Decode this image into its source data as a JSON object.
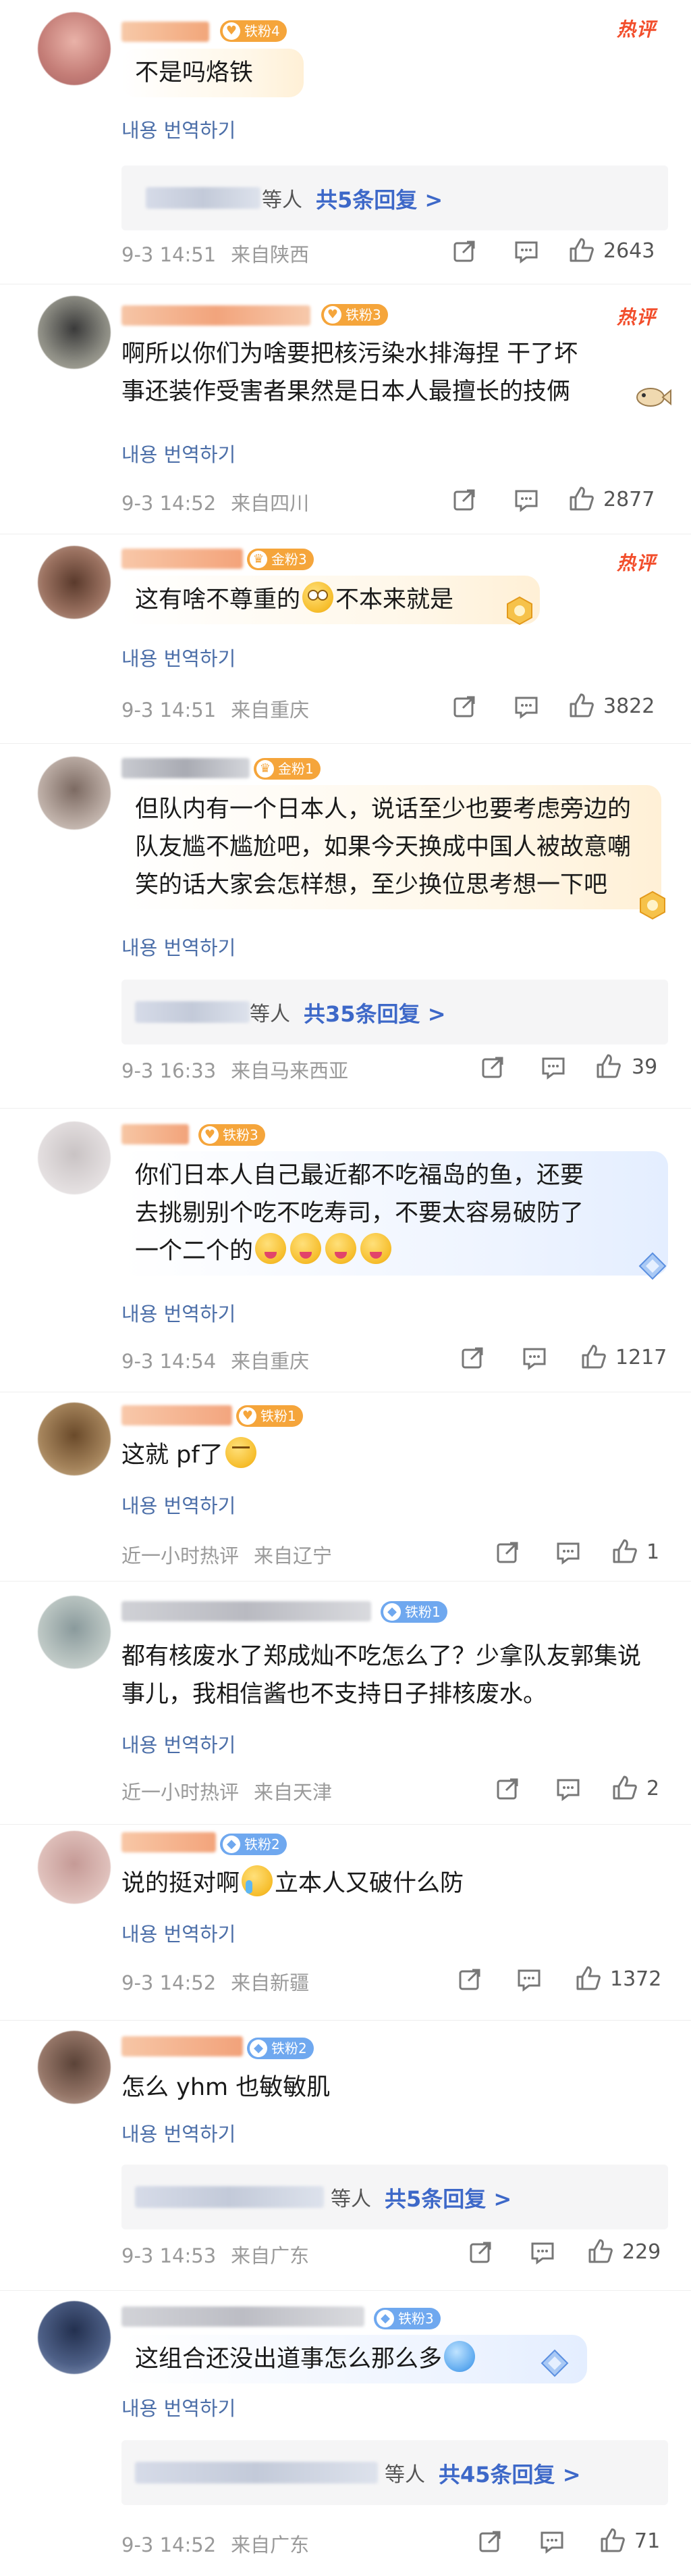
{
  "common": {
    "translate": "내용 번역하기",
    "hot": "热评",
    "more_suffix": "条回复 >",
    "who": "等人",
    "total": "共"
  },
  "comments": [
    {
      "badge": "铁粉4",
      "badge_color": "orange",
      "text": [
        "不是吗烙铁"
      ],
      "replies": "5",
      "time": "9-3 14:51",
      "loc": "来自陕西",
      "likes": "2643"
    },
    {
      "badge": "铁粉3",
      "badge_color": "orange",
      "text": [
        "啊所以你们为啥要把核污染水排海捏 干了坏",
        "事还装作受害者果然是日本人最擅长的技俩"
      ],
      "time": "9-3 14:52",
      "loc": "来自四川",
      "likes": "2877"
    },
    {
      "badge": "金粉3",
      "badge_color": "orange",
      "text": [
        "这有啥不尊重的",
        "不本来就是"
      ],
      "time": "9-3 14:51",
      "loc": "来自重庆",
      "likes": "3822"
    },
    {
      "badge": "金粉1",
      "badge_color": "orange",
      "text": [
        "但队内有一个日本人，说话至少也要考虑旁边的",
        "队友尴不尴尬吧，如果今天换成中国人被故意嘲",
        "笑的话大家会怎样想，至少换位思考想一下吧"
      ],
      "replies": "35",
      "time": "9-3 16:33",
      "loc": "来自马来西亚",
      "likes": "39"
    },
    {
      "badge": "铁粉3",
      "badge_color": "orange",
      "text": [
        "你们日本人自己最近都不吃福岛的鱼，还要",
        "去挑剔别个吃不吃寿司，不要太容易破防了",
        "一个二个的"
      ],
      "time": "9-3 14:54",
      "loc": "来自重庆",
      "likes": "1217"
    },
    {
      "badge": "铁粉1",
      "badge_color": "orange",
      "text": [
        "这就 pf了"
      ],
      "time": "近一小时热评",
      "loc": "来自辽宁",
      "likes": "1"
    },
    {
      "badge": "铁粉1",
      "badge_color": "blue",
      "text": [
        "都有核废水了郑成灿不吃怎么了？少拿队友郭集说",
        "事儿，我相信酱也不支持日子排核废水。"
      ],
      "time": "近一小时热评",
      "loc": "来自天津",
      "likes": "2"
    },
    {
      "badge": "铁粉2",
      "badge_color": "blue",
      "text": [
        "说的挺对啊",
        "立本人又破什么防"
      ],
      "time": "9-3 14:52",
      "loc": "来自新疆",
      "likes": "1372"
    },
    {
      "badge": "铁粉2",
      "badge_color": "blue",
      "text": [
        "怎么 yhm 也敏敏肌"
      ],
      "replies": "5",
      "time": "9-3 14:53",
      "loc": "来自广东",
      "likes": "229"
    },
    {
      "badge": "铁粉3",
      "badge_color": "blue",
      "text": [
        "这组合还没出道事怎么那么多"
      ],
      "replies": "45",
      "time": "9-3 14:52",
      "loc": "来自广东",
      "likes": "71"
    }
  ]
}
